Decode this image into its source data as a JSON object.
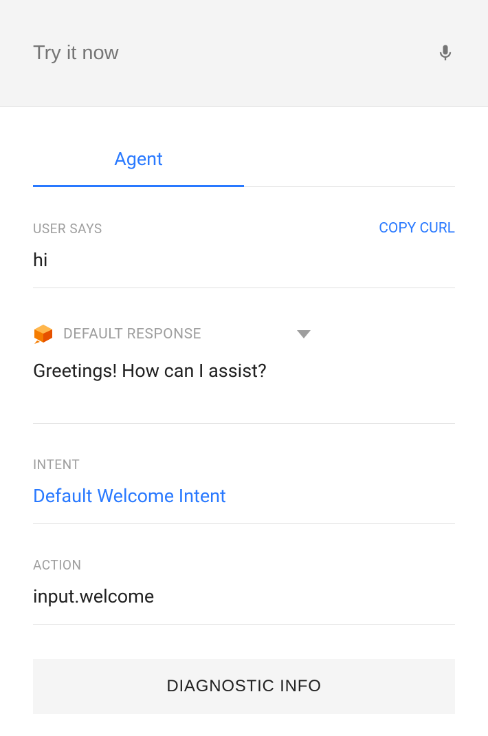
{
  "header": {
    "placeholder": "Try it now"
  },
  "tabs": {
    "agent_label": "Agent"
  },
  "user_says": {
    "label": "USER SAYS",
    "copy_curl": "COPY CURL",
    "value": "hi"
  },
  "response": {
    "label": "DEFAULT RESPONSE",
    "text": "Greetings! How can I assist?"
  },
  "intent": {
    "label": "INTENT",
    "value": "Default Welcome Intent"
  },
  "action": {
    "label": "ACTION",
    "value": "input.welcome"
  },
  "diagnostic": {
    "label": "DIAGNOSTIC INFO"
  }
}
